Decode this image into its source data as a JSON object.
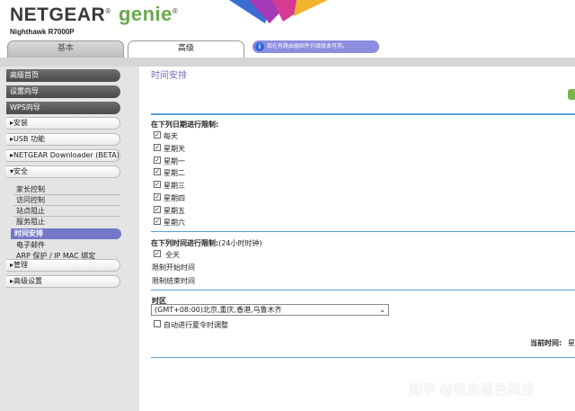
{
  "header": {
    "logo_main": "NETGEAR",
    "logo_genie": "genie",
    "logo_reg": "®",
    "model": "Nighthawk R7000P"
  },
  "tabs": [
    {
      "label": "基本",
      "active": false
    },
    {
      "label": "高级",
      "active": true
    }
  ],
  "notice": {
    "icon": "info-icon",
    "text": "现在有路由器固件升级版本可用。"
  },
  "sidebar": {
    "home": "高级首页",
    "setup_wizard": "设置向导",
    "wps_wizard": "WPS向导",
    "setup": "▸安装",
    "usb": "▸USB 功能",
    "downloader": "▸NETGEAR Downloader (BETA)",
    "security": "▾安全",
    "security_items": [
      "家长控制",
      "访问控制",
      "站点阻止",
      "服务阻止"
    ],
    "active_item": "时间安排",
    "email": "电子邮件",
    "arp": "ARP 保护 / IP MAC 绑定",
    "manage": "▸管理",
    "advanced_setup": "▸高级设置"
  },
  "main": {
    "title": "时间安排",
    "days_heading": "在下列日期进行限制:",
    "days": [
      "每天",
      "星期天",
      "星期一",
      "星期二",
      "星期三",
      "星期四",
      "星期五",
      "星期六"
    ],
    "time_heading": "在下列时间进行限制:",
    "time_hint": "(24小时时钟)",
    "all_day": "全天",
    "start_time_label": "限制开始时间",
    "end_time_label": "限制结束时间",
    "timezone_heading": "时区",
    "timezone_value": "(GMT+08:00)北京,重庆,香港,乌鲁木齐",
    "dst_label": "自动进行夏令时调整",
    "current_time_label": "当前时间:",
    "current_time_value": "星"
  },
  "watermark": "知乎 @铁血蓝色科技",
  "colors": {
    "accent_purple": "#7478c8",
    "notice_bg": "#8c8dde",
    "rule_blue": "#5a9fd4",
    "apply_green": "#7ab648"
  }
}
